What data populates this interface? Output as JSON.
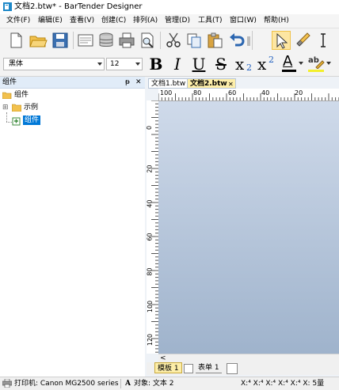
{
  "window": {
    "title": "文档2.btw* - BarTender Designer"
  },
  "menu": [
    "文件(F)",
    "编辑(E)",
    "查看(V)",
    "创建(C)",
    "排列(A)",
    "管理(D)",
    "工具(T)",
    "窗口(W)",
    "帮助(H)"
  ],
  "font_toolbar": {
    "font_name": "黑体",
    "font_size": "12",
    "bold": "B",
    "italic": "I",
    "underline": "U",
    "strike": "S",
    "subscript": "x",
    "subscript_mark": "2",
    "superscript": "x",
    "superscript_mark": "2",
    "font_color_glyph": "A",
    "highlight_glyph": "ab"
  },
  "panel": {
    "title": "组件",
    "pin_glyph": "ᵽ",
    "close_glyph": "✕",
    "tree": [
      {
        "label": "组件"
      },
      {
        "label": "示例",
        "expander": "⊞"
      },
      {
        "label": "组件",
        "selected": true
      }
    ]
  },
  "doc_tabs": [
    {
      "label": "文档1.btw"
    },
    {
      "label": "文档2.btw",
      "active": true
    }
  ],
  "doc_tab_close": "✕",
  "hruler_labels": [
    "100",
    "80",
    "60",
    "40",
    "20"
  ],
  "vruler_labels": [
    "0",
    "20",
    "40",
    "60",
    "80",
    "100",
    "120"
  ],
  "sheet_tabs": [
    "模板 1",
    "表单 1"
  ],
  "scroll_left_glyph": "<",
  "status": {
    "printer": "打印机: Canon MG2500 series",
    "object_glyph": "A",
    "object": "对象: 文本 2",
    "coords": "X:⁴ X:⁴ X:⁴ X:⁴ X:⁴ X: 5量"
  },
  "colors": {
    "selection": "#0078d7",
    "active_tab": "#fdeea9",
    "canvas_top": "#cfdaea",
    "canvas_bottom": "#9fb3cc"
  }
}
